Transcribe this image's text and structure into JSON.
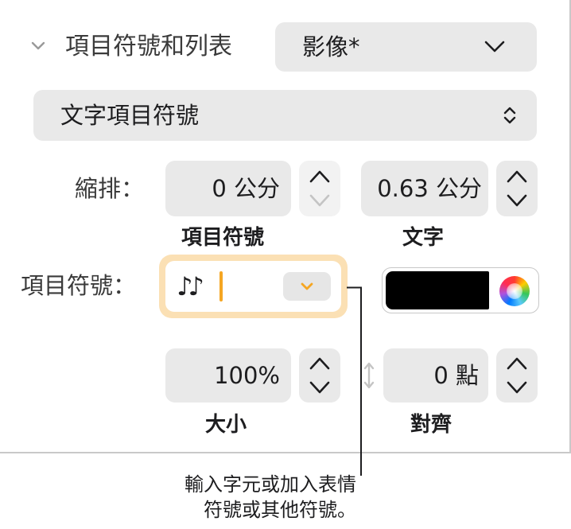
{
  "section": {
    "title": "項目符號和列表",
    "preset": "影像*"
  },
  "bullet_type": {
    "selected": "文字項目符號"
  },
  "indent": {
    "label": "縮排：",
    "bullet_value": "0 公分",
    "bullet_caption": "項目符號",
    "text_value": "0.63 公分",
    "text_caption": "文字"
  },
  "bullet": {
    "label": "項目符號：",
    "value": "♪♪",
    "color": "#000000"
  },
  "size": {
    "value": "100%",
    "caption": "大小"
  },
  "align": {
    "value": "0 點",
    "caption": "對齊"
  },
  "callout": {
    "line1": "輸入字元或加入表情",
    "line2": "符號或其他符號。"
  },
  "colors": {
    "accent": "#f5a623",
    "field": "#e9e9e9"
  }
}
